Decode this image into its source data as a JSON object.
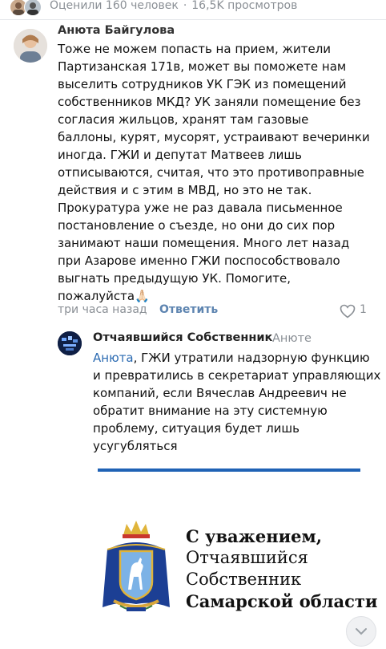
{
  "stats": {
    "rated": "Оценили 160 человек",
    "separator": "·",
    "views": "16,5K просмотров"
  },
  "comment1": {
    "author": "Анюта Байгулова",
    "text": "Тоже не можем попасть на прием, жители\nПартизанская 171в, может вы поможете нам\nвыселить сотрудников УК ГЭК из помещений\nсобственников МКД? УК заняли помещение без\nсогласия жильцов, хранят там газовые\nбаллоны, курят, мусорят, устраивают вечеринки\nиногда. ГЖИ и депутат Матвеев лишь\nотписываются, считая, что это противоправные\nдействия и с этим в МВД, но это не так.\nПрокуратура уже не раз давала письменное\nпостановление о съезде, но они до сих пор\nзанимают наши помещения. Много лет назад\nпри Азарове именно ГЖИ поспособствовало\nвыгнать предыдущую УК. Помогите,\nпожалуйста🙏🏻",
    "time": "три часа назад",
    "reply_label": "Ответить",
    "likes": "1"
  },
  "comment2": {
    "author": "Отчаявшийся Собственник",
    "reply_to": "Анюте",
    "mention": "Анюта",
    "text": ", ГЖИ утратили надзорную функцию и превратились в секретариат управляющих компаний, если Вячеслав Андреевич не обратит внимание на эту системную проблему, ситуация будет лишь усугубляться"
  },
  "signature": {
    "line1": "С уважением,",
    "line2": "Отчаявшийся",
    "line3": "Собственник",
    "line4": "Самарской области"
  },
  "colors": {
    "accent": "#2c6bb2",
    "rule": "#1f62b5",
    "muted": "#8a8f95"
  }
}
